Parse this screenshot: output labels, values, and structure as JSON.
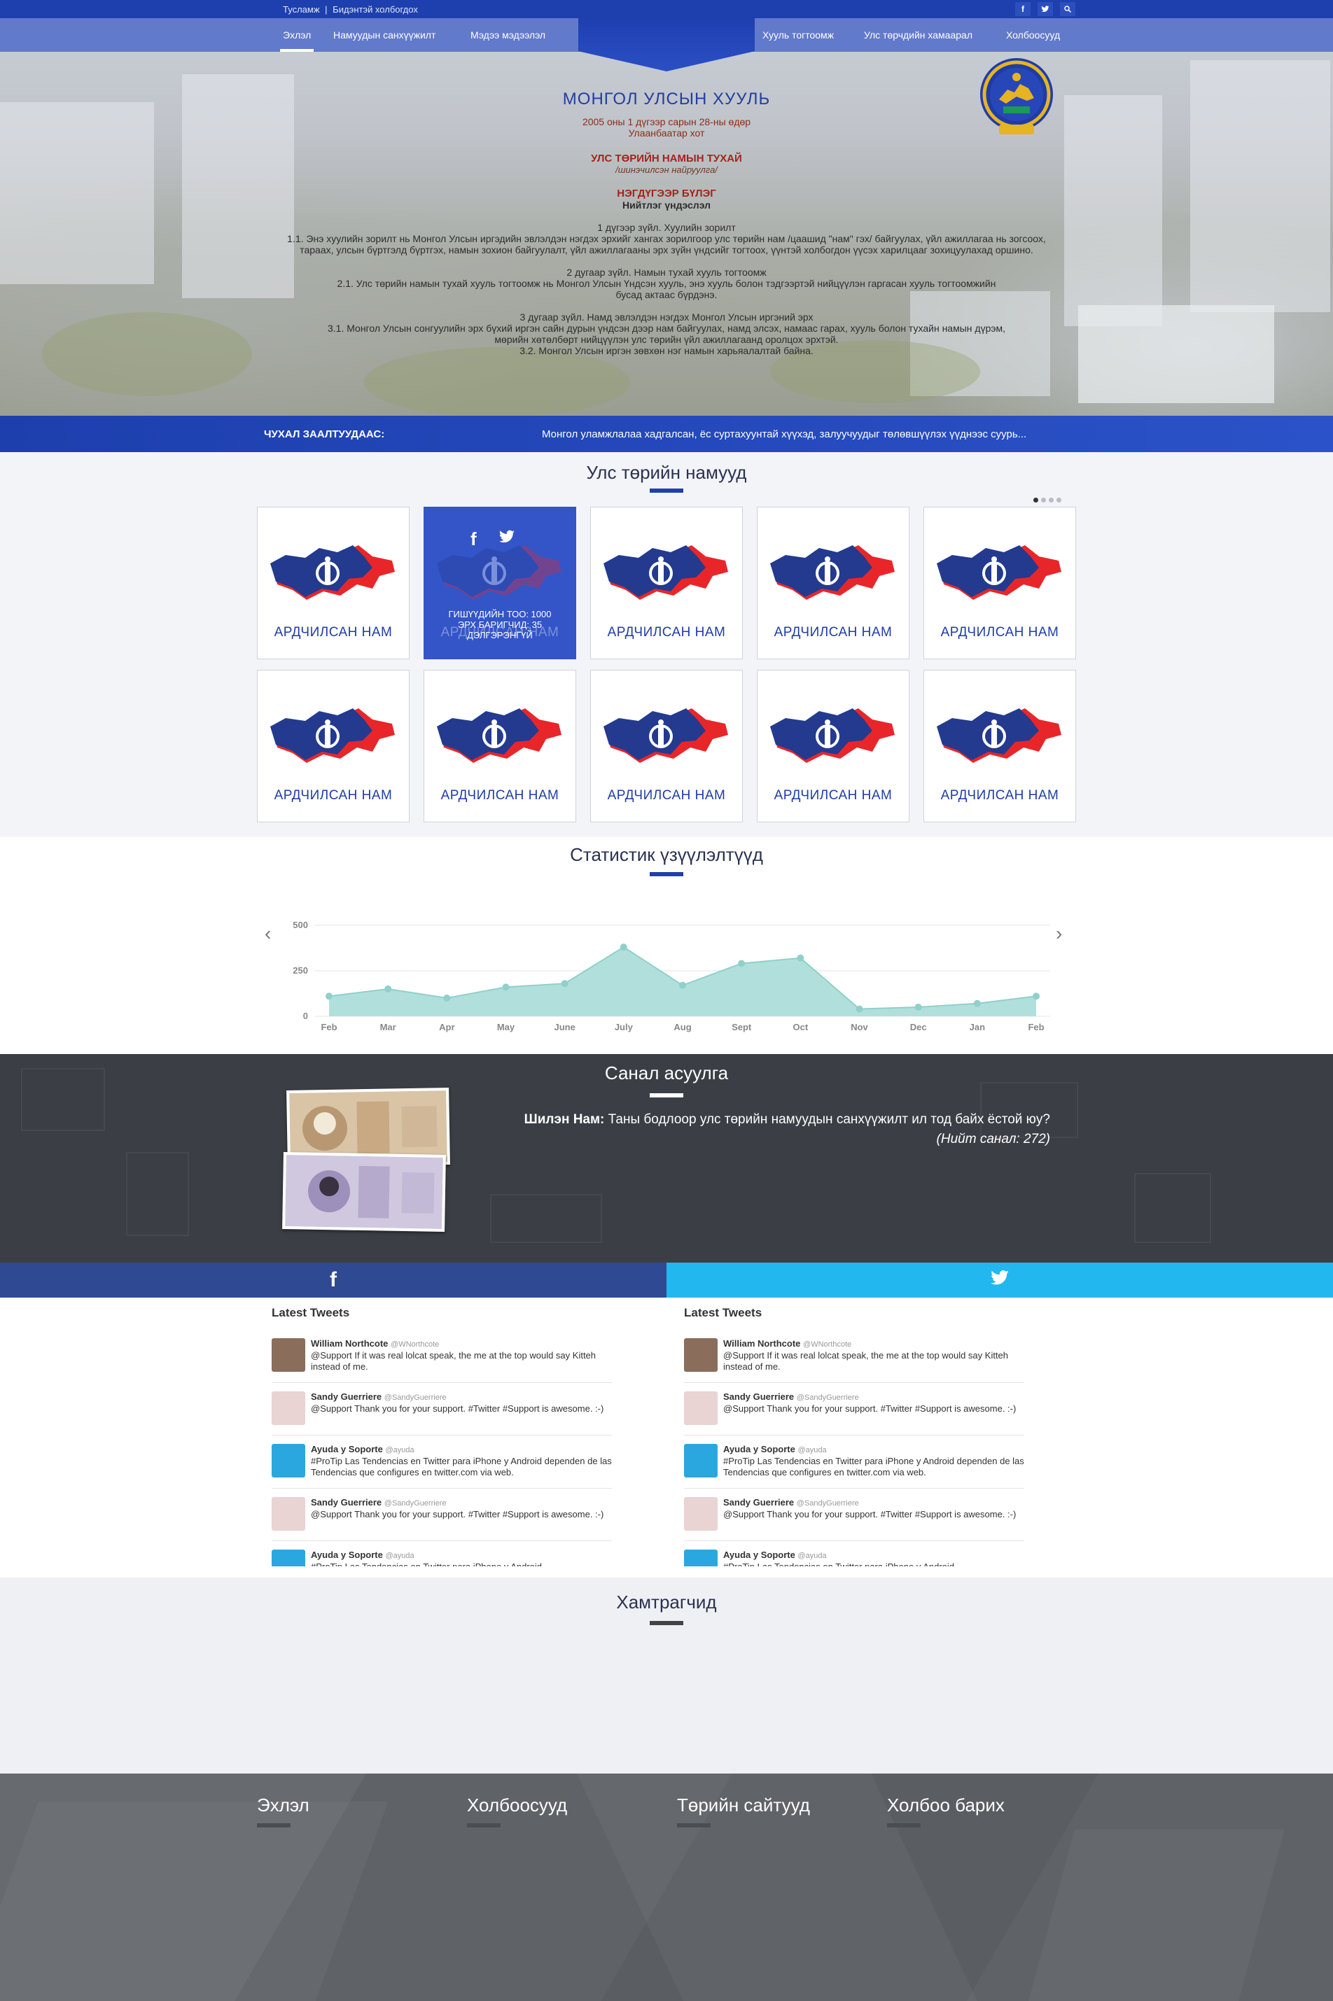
{
  "topbar": {
    "help": "Тусламж",
    "sep": "|",
    "contact": "Бидэнтэй холбогдох",
    "icons": [
      "facebook-icon",
      "twitter-icon",
      "search-icon"
    ]
  },
  "nav": {
    "left": [
      "Эхлэл",
      "Намуудын санхүүжилт",
      "Мэдээ мэдээлэл"
    ],
    "right": [
      "Хууль тогтоомж",
      "Улс төрчдийн хамаарал",
      "Холбоосууд"
    ]
  },
  "law": {
    "title": "МОНГОЛ УЛСЫН ХУУЛЬ",
    "date": "2005 оны 1 дүгээр сарын 28-ны өдөр",
    "city": "Улаанбаатар хот",
    "name": "УЛС ТӨРИЙН НАМЫН ТУХАЙ",
    "sub": "/шинэчилсэн найруулга/",
    "chapter": "НЭГДҮГЭЭР БҮЛЭГ",
    "chapter_sub": "Нийтлэг үндэслэл",
    "a1_head": "1 дүгээр зүйл. Хуулийн зорилт",
    "a1_l1": "1.1. Энэ хуулийн зорилт нь Монгол Улсын иргэдийн эвлэлдэн нэгдэх эрхийг хангах зорилгоор улс төрийн нам /цаашид \"нам\" гэх/ байгуулах, үйл ажиллагаа нь зогсоох,",
    "a1_l2": "тараах, улсын бүртгэлд бүртгэх, намын зохион байгуулалт, үйл ажиллагааны эрх зүйн үндсийг тогтоох, үүнтэй холбогдон үүсэх харилцааг зохицуулахад оршино.",
    "a2_head": "2 дугаар зүйл. Намын тухай хууль тогтоомж",
    "a2_l1": "2.1. Улс төрийн намын тухай хууль тогтоомж нь Монгол Улсын Үндсэн хууль, энэ хууль болон тэдгээртэй нийцүүлэн гаргасан хууль тогтоомжийн",
    "a2_l2": "бусад актаас бүрдэнэ.",
    "a3_head": "3 дугаар зүйл. Намд эвлэлдэн нэгдэх Монгол Улсын иргэний эрх",
    "a3_l1": "3.1. Монгол Улсын сонгуулийн эрх бүхий иргэн сайн дурын үндсэн дээр нам байгуулах, намд элсэх, намаас гарах, хууль болон тухайн намын дүрэм,",
    "a3_l2": "мөрийн хөтөлбөрт нийцүүлэн улс төрийн үйл ажиллагаанд оролцох эрхтэй.",
    "a3_l3": "3.2. Монгол Улсын иргэн зөвхөн нэг намын харьяалалтай байна."
  },
  "important": {
    "label": "ЧУХАЛ ЗААЛТУУДААС:",
    "text": "Монгол уламжлалаа хадгалсан, ёс суртахуунтай хүүхэд, залуучуудыг төлөвшүүлэх үүднээс суурь..."
  },
  "parties": {
    "title": "Улс төрийн намууд",
    "party_name": "АРДЧИЛСАН НАМ",
    "hover_members": "ГИШҮҮДИЙН ТОО: 1000",
    "hover_seats": "ЭРХ БАРИГЧИД: 35",
    "hover_more": "ДЭЛГЭРЭНГҮЙ"
  },
  "stats": {
    "title": "Статистик үзүүлэлтүүд"
  },
  "chart_data": {
    "type": "area",
    "categories": [
      "Feb",
      "Mar",
      "Apr",
      "May",
      "June",
      "July",
      "Aug",
      "Sept",
      "Oct",
      "Nov",
      "Dec",
      "Jan",
      "Feb"
    ],
    "values": [
      110,
      150,
      100,
      160,
      180,
      380,
      170,
      290,
      320,
      40,
      50,
      70,
      110
    ],
    "yticks": [
      "0",
      "250",
      "500"
    ],
    "ylim": [
      0,
      500
    ],
    "color": "#a8ddd8",
    "stroke": "#8fd0ca"
  },
  "poll": {
    "title": "Санал асуулга",
    "who": "Шилэн Нам:",
    "question": "Таны бодлоор улс төрийн намуудын санхүүжилт ил тод байх ёстой юу?",
    "total": "(Нийт санал: 272)"
  },
  "feeds": {
    "heading": "Latest Tweets",
    "items": [
      {
        "name": "William Northcote",
        "handle": "@WNorthcote",
        "text": "@Support If it was real lolcat speak, the me at the top would say Kitteh instead of me."
      },
      {
        "name": "Sandy Guerriere",
        "handle": "@SandyGuerriere",
        "text": "@Support Thank you for your support. #Twitter #Support is awesome. :-)"
      },
      {
        "name": "Ayuda y Soporte",
        "handle": "@ayuda",
        "text": "#ProTip Las Tendencias en Twitter para iPhone y Android dependen de las Tendencias que configures en twitter.com via web."
      },
      {
        "name": "Sandy Guerriere",
        "handle": "@SandyGuerriere",
        "text": "@Support Thank you for your support. #Twitter #Support is awesome. :-)"
      },
      {
        "name": "Ayuda y Soporte",
        "handle": "@ayuda",
        "text": "#ProTip Las Tendencias en Twitter para iPhone y Android"
      }
    ]
  },
  "partners": {
    "title": "Хамтрагчид"
  },
  "footer": {
    "cols": [
      "Эхлэл",
      "Холбоосууд",
      "Төрийн сайтууд",
      "Холбоо барих"
    ]
  }
}
